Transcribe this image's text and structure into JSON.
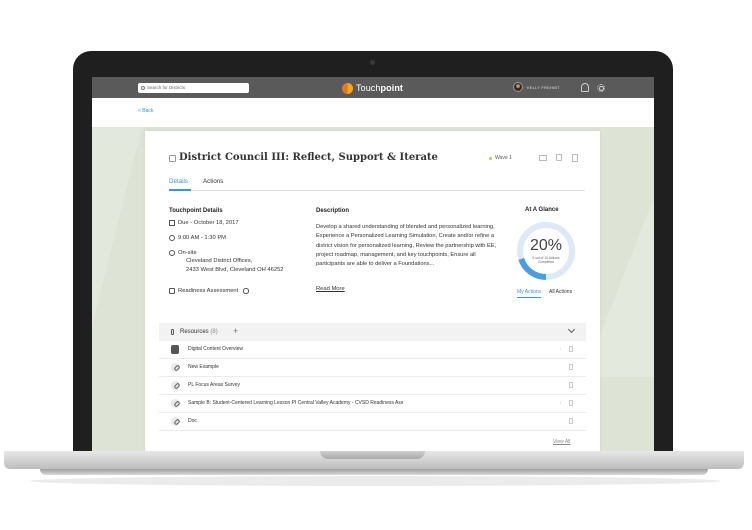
{
  "topbar": {
    "search_placeholder": "Search for Districts",
    "logo_text": "Touch",
    "logo_text_bold": "point",
    "user_name": "KELLY FREHIBT"
  },
  "nav": {
    "back_label": "< Back"
  },
  "session": {
    "title": "District Council III: Reflect, Support & Iterate",
    "wave_label": "Wave 1",
    "wave_color": "#b9cf3e",
    "icons": [
      "mail-icon",
      "copy-icon",
      "trash-icon"
    ]
  },
  "tabs": [
    {
      "label": "Details",
      "active": true
    },
    {
      "label": "Actions",
      "active": false
    }
  ],
  "details": {
    "heading": "Touchpoint Details",
    "due": "Due - October 18, 2017",
    "time": "9:00 AM - 1:30 PM",
    "location_type": "On-site",
    "location_name": "Cleveland District Offices,",
    "location_address": "2433 West Blvd, Cleveland OH 46252",
    "readiness": "Readiness Assessment"
  },
  "description": {
    "heading": "Description",
    "text": "Develop a shared understanding of blended and personalized learning, Experience a Personalized Learning Simulation, Create and/or refine a district vision for personalized learning, Review the partnership with EE, project roadmap, management, and key touchpoints, Ensure all participants are able to deliver a Foundations...",
    "read_more": "Read More"
  },
  "glance": {
    "heading": "At A Glance",
    "percent_label": "20%",
    "progress_fraction": 0.2,
    "sub_label": "5 out of 10 Actions Completed",
    "my_actions": "My Actions",
    "all_actions": "All Actions",
    "ring_color": "#4a9de0",
    "ring_track_color": "#dce9f7"
  },
  "resources": {
    "label": "Resources",
    "count": "(8)",
    "add_symbol": "+",
    "items": [
      {
        "name": "Digital Content Overview",
        "icon": "document-icon",
        "download": true
      },
      {
        "name": "New Example",
        "icon": "link-icon",
        "download": false
      },
      {
        "name": "PL Focus Areas Survey",
        "icon": "link-icon",
        "download": false
      },
      {
        "name": "Sample B: Student-Centered Learning Lesson PI Central Valley Academy - CVSD Readiness Ass",
        "icon": "link-icon",
        "download": true
      },
      {
        "name": "Doc",
        "icon": "link-icon",
        "download": false
      }
    ],
    "view_all": "View All"
  },
  "colors": {
    "accent": "#3b95d6",
    "topbar": "#5a5a5a"
  }
}
